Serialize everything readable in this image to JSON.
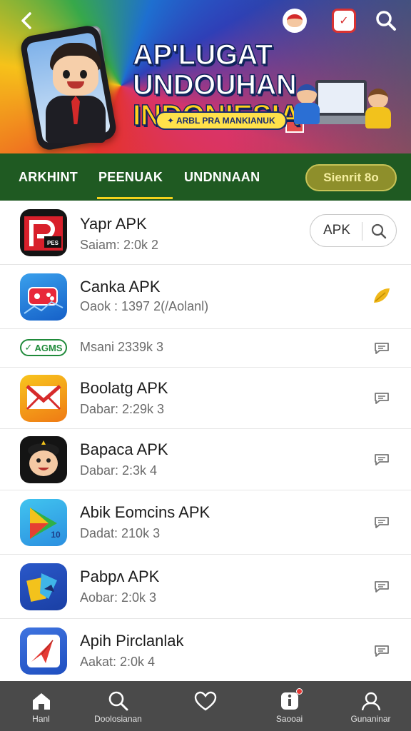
{
  "banner": {
    "title_line1": "AP'LUGAT UNDOUHAN",
    "title_line2": "INDONIESIA",
    "pill_text": "✦ ARBL PRA MANKIANUK",
    "back_icon": "chevron-left-icon",
    "top_icons": [
      "mascot-icon",
      "gift-box-icon",
      "search-icon"
    ]
  },
  "tabs": {
    "items": [
      {
        "label": "ARKHINT",
        "active": false
      },
      {
        "label": "PEENUAK",
        "active": true
      },
      {
        "label": "UNDNNAAN",
        "active": false
      }
    ],
    "cta_label": "Sienrit 8o",
    "accent": "#f4d21c",
    "bar_color": "#1f5a22"
  },
  "list": {
    "search_pill": {
      "label": "APK",
      "icon": "search-icon"
    },
    "badge_label": "AGMS",
    "items": [
      {
        "name": "Yapr APK",
        "meta": "Saiam: 2:0k 2",
        "icon": "p-logo-icon",
        "action": "apk-search"
      },
      {
        "name": "Canka APK",
        "meta": "Oaok : 1397 2(/Aolanl)",
        "icon": "game-controller-icon",
        "action": "leaf-icon"
      },
      {
        "name": "",
        "meta": "Msani 2339k 3",
        "icon": "badge",
        "action": "message-icon"
      },
      {
        "name": "Boolatg APK",
        "meta": "Dabar: 2:29k 3",
        "icon": "mail-envelope-icon",
        "action": "message-icon"
      },
      {
        "name": "Bapaca APK",
        "meta": "Dabar: 2:3k 4",
        "icon": "avatar-icon",
        "action": "message-icon"
      },
      {
        "name": "Abik Eomcins APK",
        "meta": "Dadat: 210k 3",
        "icon": "play-triangle-icon",
        "action": "message-icon"
      },
      {
        "name": "Pabpʌ APK",
        "meta": "Aobar: 2:0k 3",
        "icon": "blocks-icon",
        "action": "message-icon"
      },
      {
        "name": "Apih Pirclanlak",
        "meta": "Aakat: 2:0k 4",
        "icon": "paper-plane-icon",
        "action": "message-icon"
      }
    ]
  },
  "bottom_nav": {
    "items": [
      {
        "label": "Hanl",
        "icon": "home-icon"
      },
      {
        "label": "Doolosianan",
        "icon": "search-icon"
      },
      {
        "label": "",
        "icon": "heart-icon"
      },
      {
        "label": "Saooai",
        "icon": "info-badge-icon"
      },
      {
        "label": "Gunaninar",
        "icon": "profile-icon"
      }
    ]
  }
}
